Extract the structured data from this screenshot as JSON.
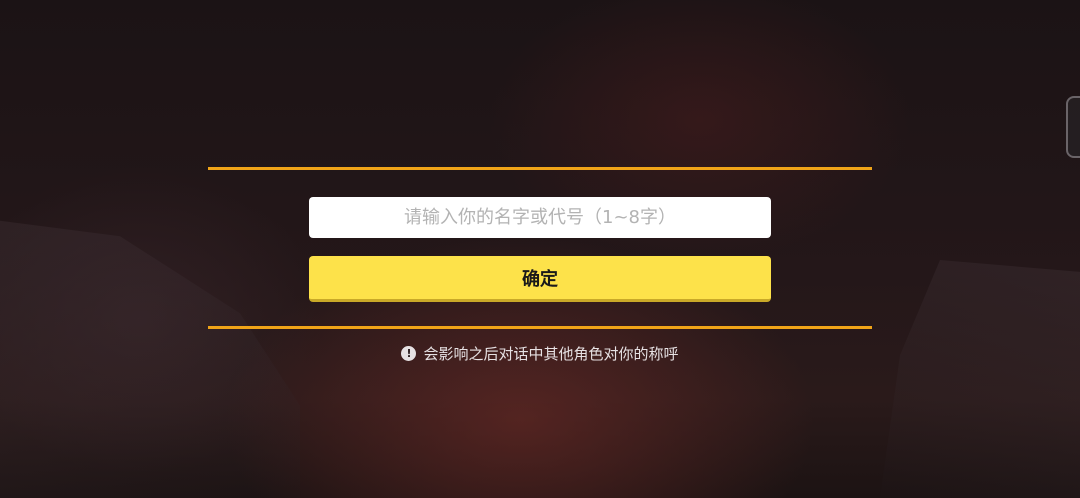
{
  "name_form": {
    "input_placeholder": "请输入你的名字或代号（1~8字）",
    "input_value": "",
    "confirm_label": "确定",
    "notice_icon": "exclamation-circle-icon",
    "notice_text": "会影响之后对话中其他角色对你的称呼"
  },
  "colors": {
    "accent_line": "#f0a418",
    "button_yellow": "#fde24a",
    "notice_text": "#e6e1e3"
  }
}
